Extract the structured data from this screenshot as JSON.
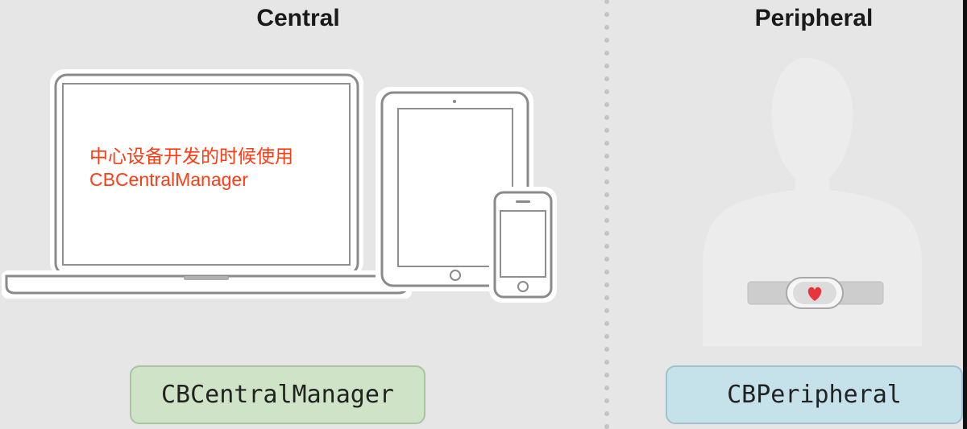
{
  "central": {
    "title": "Central",
    "annotation_line1": "中心设备开发的时候使用",
    "annotation_line2": "CBCentralManager",
    "class_label": "CBCentralManager"
  },
  "peripheral": {
    "title": "Peripheral",
    "class_label": "CBPeripheral"
  },
  "colors": {
    "background": "#e6e6e6",
    "annotation": "#ff3b14",
    "central_box": "#cfe4c7",
    "peripheral_box": "#c5e2ea",
    "heart": "#e8343c"
  },
  "icons": [
    "laptop-icon",
    "tablet-icon",
    "phone-icon",
    "person-silhouette-icon",
    "heart-icon"
  ]
}
